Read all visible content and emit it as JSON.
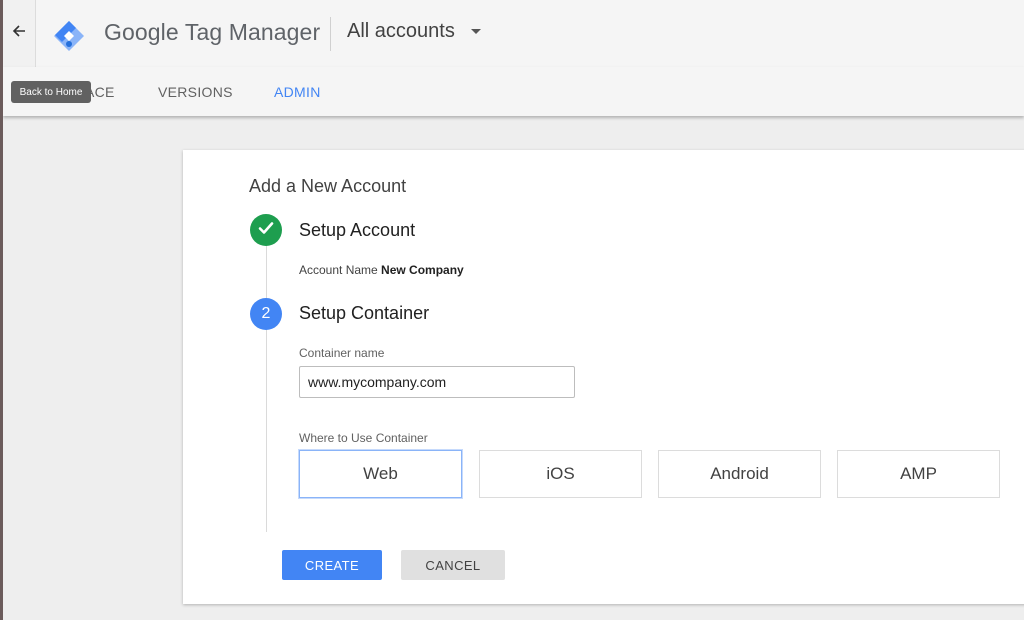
{
  "header": {
    "brand_google": "Google",
    "brand_product": "Tag Manager",
    "account_switcher": "All accounts",
    "back_tooltip": "Back to Home"
  },
  "tabs": [
    {
      "label": "ACE",
      "active": false
    },
    {
      "label": "VERSIONS",
      "active": false
    },
    {
      "label": "ADMIN",
      "active": true
    }
  ],
  "form": {
    "title": "Add a New Account",
    "step1": {
      "title": "Setup Account",
      "account_name_label": "Account Name",
      "account_name_value": "New Company"
    },
    "step2": {
      "number": "2",
      "title": "Setup Container",
      "container_name_label": "Container name",
      "container_name_value": "www.mycompany.com",
      "where_label": "Where to Use Container",
      "platforms": [
        {
          "label": "Web",
          "selected": true
        },
        {
          "label": "iOS",
          "selected": false
        },
        {
          "label": "Android",
          "selected": false
        },
        {
          "label": "AMP",
          "selected": false
        }
      ]
    },
    "buttons": {
      "create": "CREATE",
      "cancel": "CANCEL"
    }
  },
  "colors": {
    "accent": "#4285f4",
    "success": "#1e9e4f"
  },
  "icons": [
    "back-arrow-icon",
    "gtm-logo-icon",
    "caret-down-icon",
    "checkmark-icon"
  ]
}
